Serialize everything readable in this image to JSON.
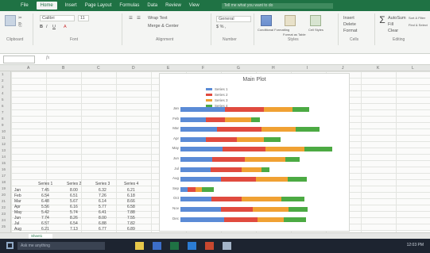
{
  "ribbon_tabs": [
    "File",
    "Home",
    "Insert",
    "Page Layout",
    "Formulas",
    "Data",
    "Review",
    "View"
  ],
  "active_tab_index": 1,
  "tell_me_placeholder": "Tell me what you want to do",
  "ribbon_groups": [
    "Clipboard",
    "Font",
    "Alignment",
    "Number",
    "Styles",
    "Cells",
    "Editing"
  ],
  "ribbon_controls": {
    "font_name": "Calibri",
    "font_size": "11",
    "wrap_text": "Wrap Text",
    "merge_center": "Merge & Center",
    "number_format": "General",
    "conditional_formatting": "Conditional Formatting",
    "format_as_table": "Format as Table",
    "cell_styles": "Cell Styles",
    "insert": "Insert",
    "delete": "Delete",
    "format": "Format",
    "autosum": "AutoSum",
    "fill": "Fill",
    "clear": "Clear",
    "sort_filter": "Sort & Filter",
    "find_select": "Find & Select"
  },
  "formula_bar": {
    "fx": "fx"
  },
  "columns": [
    "A",
    "B",
    "C",
    "D",
    "E",
    "F",
    "G",
    "H",
    "I",
    "J",
    "K",
    "L"
  ],
  "rows": [
    "1",
    "2",
    "3",
    "4",
    "5",
    "6",
    "7",
    "8",
    "9",
    "10",
    "11",
    "12",
    "13",
    "14",
    "15",
    "16",
    "17",
    "18",
    "19",
    "20",
    "21",
    "22",
    "23",
    "24",
    "25"
  ],
  "table": {
    "headers": [
      "Series 1",
      "Series 2",
      "Series 3",
      "Series 4"
    ],
    "row_labels": [
      "Jan",
      "Feb",
      "Mar",
      "Apr",
      "May",
      "Jun",
      "Jul",
      "Aug"
    ],
    "cells": [
      [
        "7.45",
        "8.00",
        "6.32",
        "6.21"
      ],
      [
        "6.54",
        "6.51",
        "7.26",
        "6.18"
      ],
      [
        "6.48",
        "5.67",
        "6.14",
        "8.66"
      ],
      [
        "5.56",
        "6.16",
        "5.77",
        "6.58"
      ],
      [
        "5.42",
        "5.74",
        "6.41",
        "7.88"
      ],
      [
        "7.74",
        "8.26",
        "8.00",
        "7.55"
      ],
      [
        "6.57",
        "6.54",
        "6.88",
        "7.82"
      ],
      [
        "6.21",
        "7.13",
        "6.77",
        "6.89"
      ]
    ]
  },
  "chart_data": {
    "type": "bar",
    "orientation": "horizontal",
    "stacked": true,
    "title": "Main Plot",
    "series": [
      {
        "name": "Series 1",
        "color": "#5b8bd6",
        "values": [
          6.2,
          3.6,
          5.1,
          3.5,
          5.9,
          4.4,
          4.2,
          5.7,
          1.0,
          4.3,
          5.7,
          6.1
        ]
      },
      {
        "name": "Series 2",
        "color": "#e04b3f",
        "values": [
          5.5,
          2.6,
          6.2,
          4.4,
          6.0,
          4.6,
          4.4,
          4.9,
          1.1,
          4.3,
          4.4,
          4.7
        ]
      },
      {
        "name": "Series 3",
        "color": "#f0a133",
        "values": [
          4.0,
          3.7,
          4.8,
          3.8,
          5.4,
          5.7,
          2.7,
          4.4,
          0.9,
          5.5,
          5.0,
          3.6
        ]
      },
      {
        "name": "Series 4",
        "color": "#4caa43",
        "values": [
          2.3,
          1.2,
          3.3,
          2.3,
          3.9,
          2.0,
          1.1,
          2.7,
          1.7,
          3.2,
          2.7,
          3.2
        ]
      }
    ],
    "categories": [
      "Jan",
      "Feb",
      "Mar",
      "Apr",
      "May",
      "Jun",
      "Jul",
      "Aug",
      "Sep",
      "Oct",
      "Nov",
      "Dec"
    ],
    "legend_position": "top-left",
    "grid": false
  },
  "sheet_tab": "Sheet1",
  "taskbar": {
    "search_placeholder": "Ask me anything",
    "app_colors": [
      "#e8c84a",
      "#3c6ec8",
      "#1f7244",
      "#2b7cd3",
      "#c8482f",
      "#a3b4c8"
    ],
    "clock": "12:03 PM"
  }
}
